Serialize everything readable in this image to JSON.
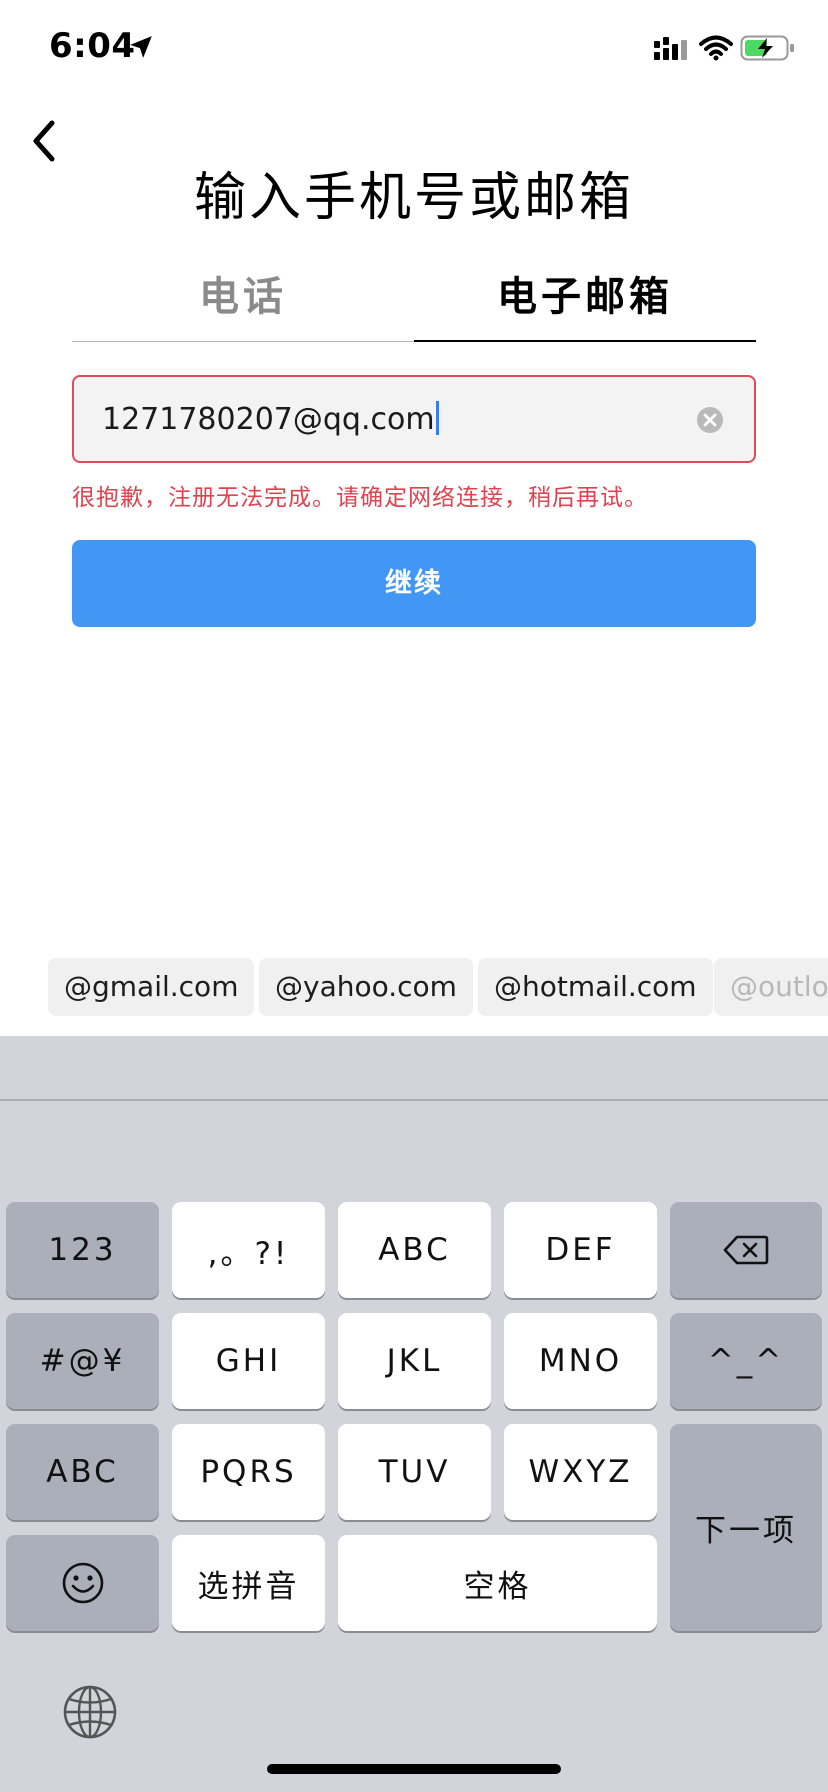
{
  "status_bar": {
    "time": "6:04"
  },
  "header": {
    "title": "输入手机号或邮箱"
  },
  "tabs": [
    {
      "label": "电话",
      "active": false
    },
    {
      "label": "电子邮箱",
      "active": true
    }
  ],
  "email_field": {
    "value": "1271780207@qq.com"
  },
  "error_message": "很抱歉，注册无法完成。请确定网络连接，稍后再试。",
  "continue_button": {
    "label": "继续"
  },
  "domain_suggestions": [
    "@gmail.com",
    "@yahoo.com",
    "@hotmail.com",
    "@outlo"
  ],
  "keyboard": {
    "row1": {
      "left": "123",
      "k1": ",。?!",
      "k2": "ABC",
      "k3": "DEF"
    },
    "row2": {
      "left": "#@¥",
      "k1": "GHI",
      "k2": "JKL",
      "k3": "MNO",
      "right": "^_^"
    },
    "row3": {
      "left": "ABC",
      "k1": "PQRS",
      "k2": "TUV",
      "k3": "WXYZ"
    },
    "row4": {
      "k1": "选拼音",
      "space": "空格"
    },
    "next": "下一项"
  },
  "colors": {
    "accent": "#4296f4",
    "error": "#e0434f",
    "keyboard_bg": "#d1d4db"
  }
}
